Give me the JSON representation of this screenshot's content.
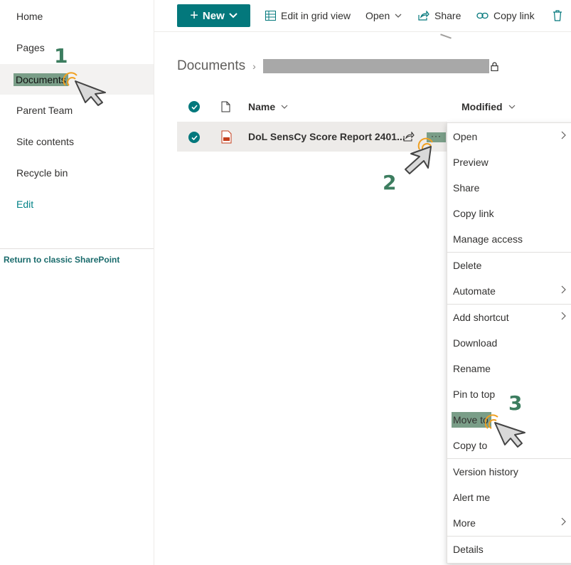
{
  "sidebar": {
    "items": [
      {
        "label": "Home"
      },
      {
        "label": "Pages"
      },
      {
        "label": "Documents"
      },
      {
        "label": "Parent Team"
      },
      {
        "label": "Site contents"
      },
      {
        "label": "Recycle bin"
      },
      {
        "label": "Edit"
      }
    ],
    "classic_link": "Return to classic SharePoint"
  },
  "steps": [
    "1",
    "2",
    "3"
  ],
  "toolbar": {
    "new_label": "New",
    "grid_label": "Edit in grid view",
    "open_label": "Open",
    "share_label": "Share",
    "copy_link_label": "Copy link"
  },
  "breadcrumb": {
    "root": "Documents"
  },
  "columns": {
    "name": "Name",
    "modified": "Modified"
  },
  "file": {
    "name": "DoL SensCy Score Report 2401..."
  },
  "context_menu": {
    "items": [
      {
        "label": "Open",
        "submenu": true
      },
      {
        "label": "Preview"
      },
      {
        "label": "Share"
      },
      {
        "label": "Copy link"
      },
      {
        "label": "Manage access"
      },
      {
        "label": "Delete"
      },
      {
        "label": "Automate",
        "submenu": true
      },
      {
        "label": "Add shortcut",
        "submenu": true
      },
      {
        "label": "Download"
      },
      {
        "label": "Rename"
      },
      {
        "label": "Pin to top"
      },
      {
        "label": "Move to"
      },
      {
        "label": "Copy to"
      },
      {
        "label": "Version history"
      },
      {
        "label": "Alert me"
      },
      {
        "label": "More",
        "submenu": true
      },
      {
        "label": "Details"
      }
    ]
  },
  "colors": {
    "accent": "#03787c",
    "highlight": "#7a9e88",
    "step": "#3c7d5f",
    "click_ring": "#f0a020"
  }
}
